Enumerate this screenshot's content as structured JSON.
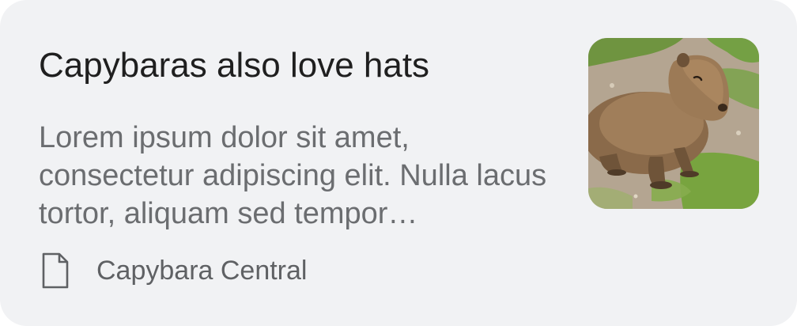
{
  "card": {
    "title": "Capybaras also love hats",
    "snippet": "Lorem ipsum dolor sit amet, consectetur adipiscing elit. Nulla lacus tortor, aliquam sed tempor…",
    "source_icon": "document-icon",
    "source_label": "Capybara Central",
    "thumbnail_icon": "capybara-photo"
  },
  "colors": {
    "card_background": "#f1f2f4",
    "title": "#1f1f1f",
    "snippet": "#6b6d70",
    "source": "#5f6164"
  }
}
